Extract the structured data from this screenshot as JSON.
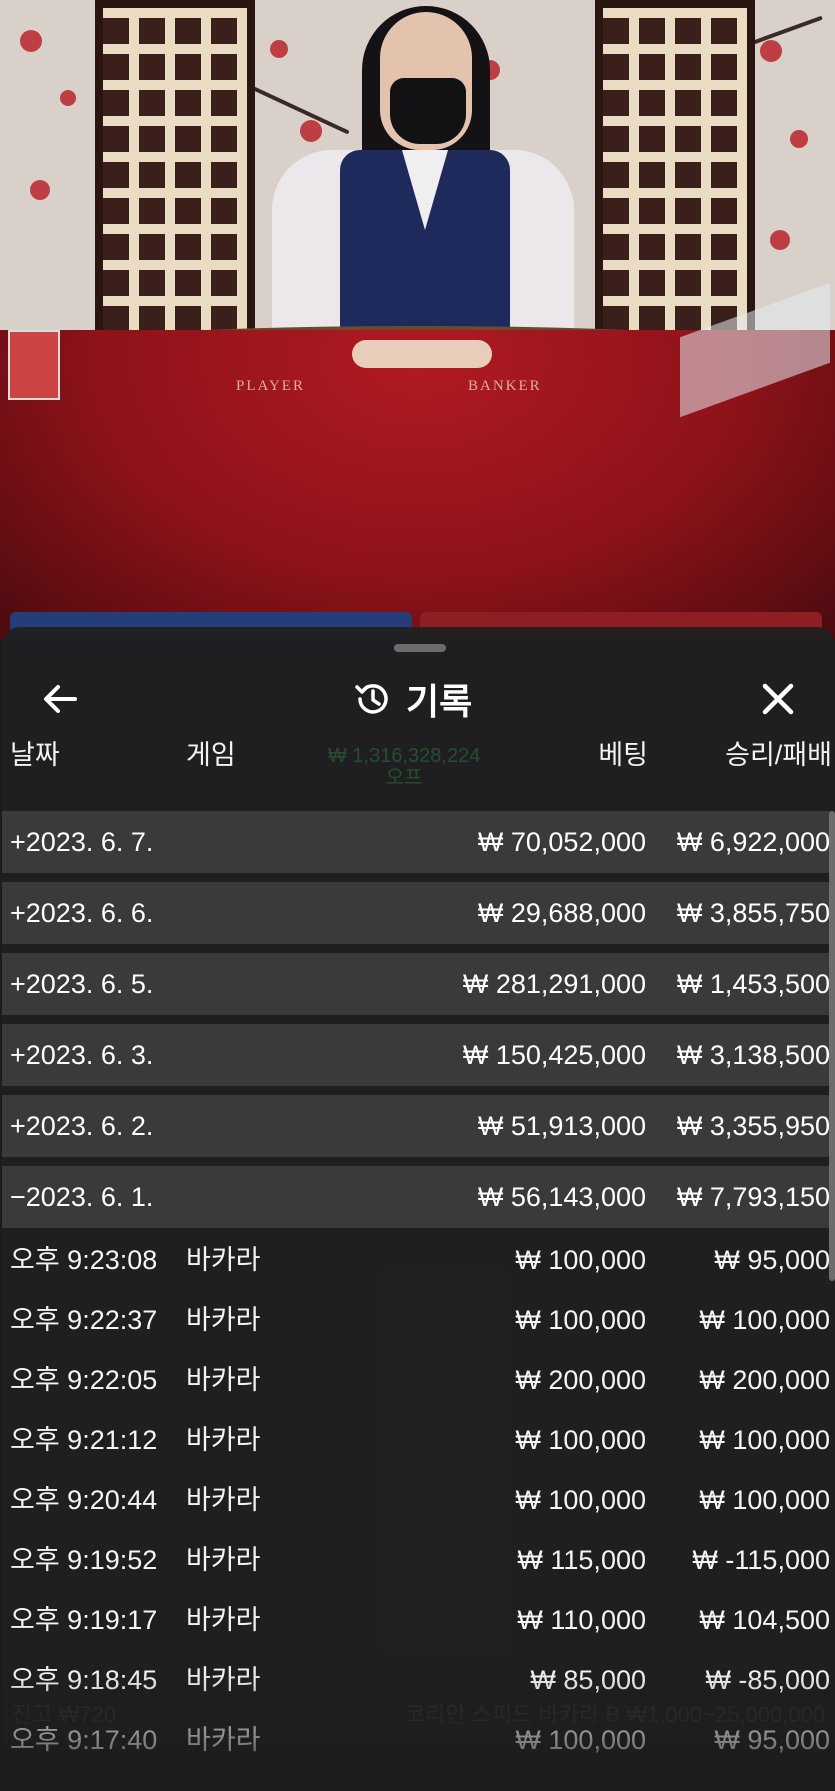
{
  "scene": {
    "felt_left": "PLAYER",
    "felt_right": "BANKER"
  },
  "header": {
    "title": "기록",
    "back_icon": "arrow-left-icon",
    "history_icon": "history-clock-icon",
    "close_icon": "close-x-icon"
  },
  "columns": {
    "date": "날짜",
    "game": "게임",
    "bet": "베팅",
    "result": "승리/패배"
  },
  "background_overlay": {
    "balance_line1": "₩ 1,316,328,224",
    "balance_line2": "오프"
  },
  "day_rows": [
    {
      "date": "+2023. 6. 7.",
      "bet": "₩ 70,052,000",
      "result": "₩ 6,922,000"
    },
    {
      "date": "+2023. 6. 6.",
      "bet": "₩ 29,688,000",
      "result": "₩ 3,855,750"
    },
    {
      "date": "+2023. 6. 5.",
      "bet": "₩ 281,291,000",
      "result": "₩ 1,453,500"
    },
    {
      "date": "+2023. 6. 3.",
      "bet": "₩ 150,425,000",
      "result": "₩ 3,138,500"
    },
    {
      "date": "+2023. 6. 2.",
      "bet": "₩ 51,913,000",
      "result": "₩ 3,355,950"
    },
    {
      "date": "−2023. 6. 1.",
      "bet": "₩ 56,143,000",
      "result": "₩ 7,793,150"
    }
  ],
  "round_rows": [
    {
      "time": "오후 9:23:08",
      "game": "바카라",
      "bet": "₩ 100,000",
      "result": "₩ 95,000"
    },
    {
      "time": "오후 9:22:37",
      "game": "바카라",
      "bet": "₩ 100,000",
      "result": "₩ 100,000"
    },
    {
      "time": "오후 9:22:05",
      "game": "바카라",
      "bet": "₩ 200,000",
      "result": "₩ 200,000"
    },
    {
      "time": "오후 9:21:12",
      "game": "바카라",
      "bet": "₩ 100,000",
      "result": "₩ 100,000"
    },
    {
      "time": "오후 9:20:44",
      "game": "바카라",
      "bet": "₩ 100,000",
      "result": "₩ 100,000"
    },
    {
      "time": "오후 9:19:52",
      "game": "바카라",
      "bet": "₩ 115,000",
      "result": "₩ -115,000"
    },
    {
      "time": "오후 9:19:17",
      "game": "바카라",
      "bet": "₩ 110,000",
      "result": "₩ 104,500"
    },
    {
      "time": "오후 9:18:45",
      "game": "바카라",
      "bet": "₩ 85,000",
      "result": "₩ -85,000"
    },
    {
      "time": "오후 9:17:40",
      "game": "바카라",
      "bet": "₩ 100,000",
      "result": "₩ 95,000"
    }
  ],
  "underlay_text": {
    "left_bottom": "잔고 ₩720",
    "right_bottom": "코리안 스피드 바카라 B ₩1,000~25,000,000"
  },
  "colors": {
    "sheet_bg": "#202022",
    "day_row_bg": "#3a3a3c",
    "text": "#ffffff",
    "table_red": "#a8161f",
    "player_blue": "#243e7a"
  }
}
